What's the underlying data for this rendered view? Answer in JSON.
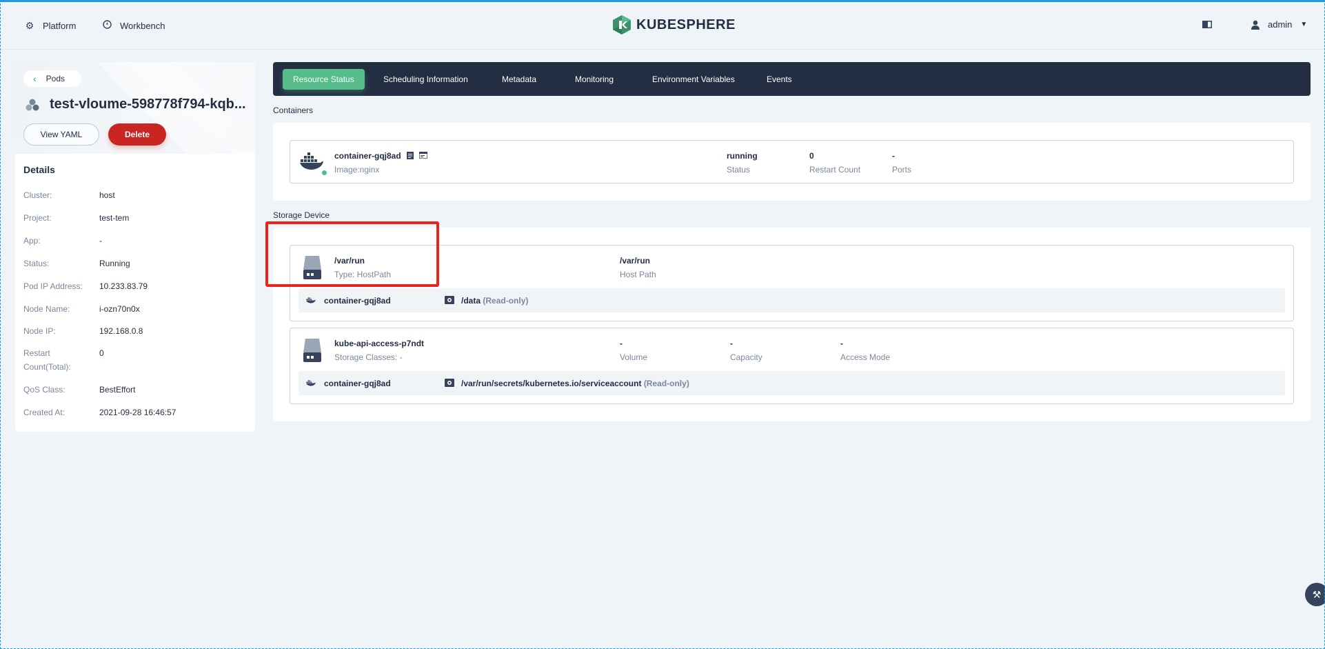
{
  "header": {
    "nav": [
      {
        "label": "Platform",
        "icon": "gear-icon"
      },
      {
        "label": "Workbench",
        "icon": "compass-icon"
      }
    ],
    "logo_text": "KUBESPHERE",
    "user": "admin"
  },
  "left_panel": {
    "back_label": "Pods",
    "pod_name": "test-vloume-598778f794-kqb...",
    "view_yaml_label": "View YAML",
    "delete_label": "Delete",
    "details_title": "Details",
    "details": [
      {
        "key": "Cluster:",
        "value": "host"
      },
      {
        "key": "Project:",
        "value": "test-tem"
      },
      {
        "key": "App:",
        "value": "-"
      },
      {
        "key": "Status:",
        "value": "Running"
      },
      {
        "key": "Pod IP Address:",
        "value": "10.233.83.79"
      },
      {
        "key": "Node Name:",
        "value": "i-ozn70n0x"
      },
      {
        "key": "Node IP:",
        "value": "192.168.0.8"
      },
      {
        "key": "Restart Count(Total):",
        "value": "0"
      },
      {
        "key": "QoS Class:",
        "value": "BestEffort"
      },
      {
        "key": "Created At:",
        "value": "2021-09-28 16:46:57"
      }
    ]
  },
  "tabs": [
    {
      "label": "Resource Status",
      "active": true
    },
    {
      "label": "Scheduling Information",
      "active": false
    },
    {
      "label": "Metadata",
      "active": false
    },
    {
      "label": "Monitoring",
      "active": false
    },
    {
      "label": "Environment Variables",
      "active": false
    },
    {
      "label": "Events",
      "active": false
    }
  ],
  "containers": {
    "title": "Containers",
    "items": [
      {
        "name": "container-gqj8ad",
        "image": "Image:nginx",
        "status_value": "running",
        "status_label": "Status",
        "restart_value": "0",
        "restart_label": "Restart Count",
        "ports_value": "-",
        "ports_label": "Ports"
      }
    ]
  },
  "storage": {
    "title": "Storage Device",
    "items": [
      {
        "name": "/var/run",
        "type": "Type: HostPath",
        "col1_value": "/var/run",
        "col1_label": "Host Path",
        "mount": {
          "container": "container-gqj8ad",
          "path": "/data",
          "mode": "(Read-only)"
        }
      },
      {
        "name": "kube-api-access-p7ndt",
        "type": "Storage Classes: -",
        "col1_value": "-",
        "col1_label": "Volume",
        "col2_value": "-",
        "col2_label": "Capacity",
        "col3_value": "-",
        "col3_label": "Access Mode",
        "mount": {
          "container": "container-gqj8ad",
          "path": "/var/run/secrets/kubernetes.io/serviceaccount",
          "mode": "(Read-only)"
        }
      }
    ]
  },
  "colors": {
    "accent_green": "#55bc8a",
    "danger_red": "#ca2621",
    "dark_navy": "#242e42",
    "highlight_red": "#e8251b"
  }
}
